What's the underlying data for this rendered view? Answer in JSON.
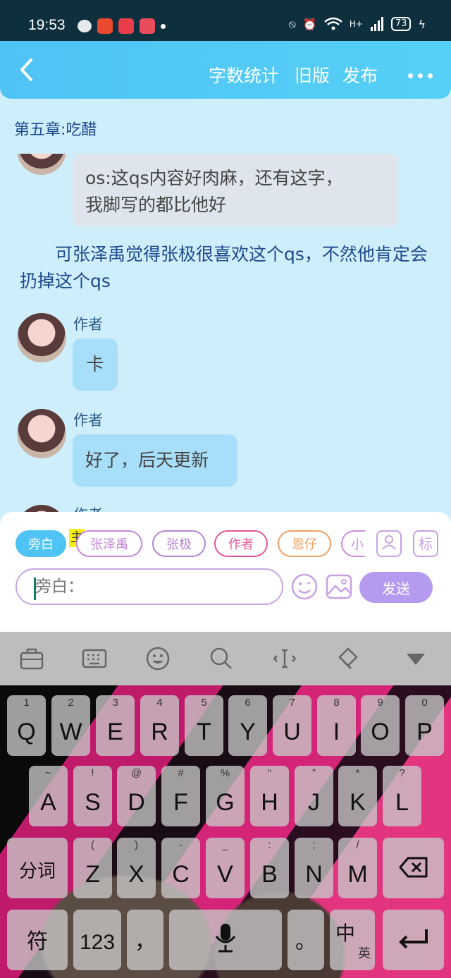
{
  "status_bar": {
    "time": "19:53",
    "battery": "73",
    "network": "H+"
  },
  "header": {
    "links": [
      "字数统计",
      "旧版",
      "发布"
    ]
  },
  "chapter_title": "第五章:吃醋",
  "messages": [
    {
      "type": "bubble",
      "style": "gray",
      "lines": [
        "os:这qs内容好肉麻，还有这字，",
        "我脚写的都比他好"
      ]
    },
    {
      "type": "narration",
      "text": "可张泽禹觉得张极很喜欢这个qs，不然他肯定会扔掉这个qs"
    },
    {
      "type": "bubble",
      "style": "blue",
      "name": "作者",
      "text": "卡"
    },
    {
      "type": "bubble",
      "style": "blue",
      "name": "作者",
      "text": "好了，后天更新"
    },
    {
      "type": "partial",
      "name": "作者"
    }
  ],
  "roles": {
    "chips": [
      {
        "label": "旁白",
        "color": "#4fc3f4",
        "active": true
      },
      {
        "label": "张泽禹",
        "color": "#c686d8"
      },
      {
        "label": "张极",
        "color": "#b584d6"
      },
      {
        "label": "作者",
        "color": "#e0589a"
      },
      {
        "label": "恩仔",
        "color": "#f0a062"
      },
      {
        "label": "小",
        "color": "#d08ae0"
      }
    ],
    "main_badge": "主",
    "tag_button": "标"
  },
  "input": {
    "placeholder": "旁白："
  },
  "send_label": "发送",
  "keyboard": {
    "row1": [
      [
        "Q",
        "1"
      ],
      [
        "W",
        "2"
      ],
      [
        "E",
        "3"
      ],
      [
        "R",
        "4"
      ],
      [
        "T",
        "5"
      ],
      [
        "Y",
        "6"
      ],
      [
        "U",
        "7"
      ],
      [
        "I",
        "8"
      ],
      [
        "O",
        "9"
      ],
      [
        "P",
        "0"
      ]
    ],
    "row2": [
      [
        "A",
        "~"
      ],
      [
        "S",
        "!"
      ],
      [
        "D",
        "@"
      ],
      [
        "F",
        "#"
      ],
      [
        "G",
        "%"
      ],
      [
        "H",
        "“"
      ],
      [
        "J",
        "”"
      ],
      [
        "K",
        "*"
      ],
      [
        "L",
        "?"
      ]
    ],
    "row3": [
      [
        "Z",
        "("
      ],
      [
        "X",
        ")"
      ],
      [
        "C",
        "-"
      ],
      [
        "V",
        "_"
      ],
      [
        "B",
        ":"
      ],
      [
        "N",
        ";"
      ],
      [
        "M",
        "/"
      ]
    ],
    "fenci": "分词",
    "fu": "符",
    "num": "123",
    "comma": "，",
    "period": "。",
    "lang_main": "中",
    "lang_alt": "英"
  },
  "colors": {
    "header": "#4fc3f4",
    "send": "#b59af0",
    "chat_bg": "#cfeefc"
  }
}
